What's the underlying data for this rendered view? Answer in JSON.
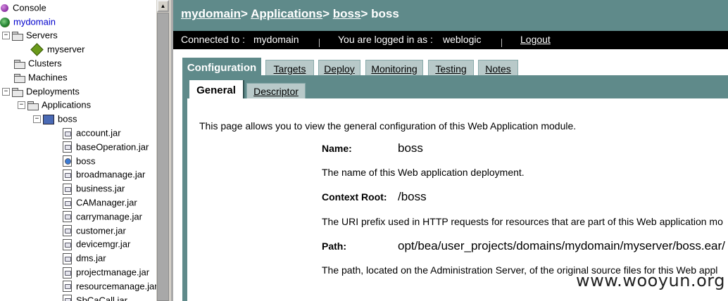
{
  "tree": {
    "console": "Console",
    "domain": "mydomain",
    "servers": "Servers",
    "server": "myserver",
    "clusters": "Clusters",
    "machines": "Machines",
    "deployments": "Deployments",
    "applications": "Applications",
    "app": "boss",
    "modules": [
      "account.jar",
      "baseOperation.jar",
      "boss",
      "broadmanage.jar",
      "business.jar",
      "CAManager.jar",
      "carrymanage.jar",
      "customer.jar",
      "devicemgr.jar",
      "dms.jar",
      "projectmanage.jar",
      "resourcemanage.jar",
      "SbCaCall.jar"
    ],
    "expand_symbol": "−"
  },
  "header": {
    "crumb_domain": "mydomain",
    "crumb_apps": "Applications",
    "crumb_boss": "boss",
    "crumb_current": "boss",
    "sep": ">"
  },
  "status": {
    "connected_label": "Connected to :",
    "connected_value": "mydomain",
    "logged_label": "You are logged in as :",
    "logged_value": "weblogic",
    "logout": "Logout"
  },
  "tabs": [
    "Configuration",
    "Targets",
    "Deploy",
    "Monitoring",
    "Testing",
    "Notes"
  ],
  "subtabs": [
    "General",
    "Descriptor"
  ],
  "content": {
    "intro": "This page allows you to view the general configuration of this Web Application module.",
    "name_label": "Name:",
    "name_value": "boss",
    "name_desc": "The name of this Web application deployment.",
    "root_label": "Context Root:",
    "root_value": "/boss",
    "root_desc": "The URI prefix used in HTTP requests for resources that are part of this Web application mo",
    "path_label": "Path:",
    "path_value": "opt/bea/user_projects/domains/mydomain/myserver/boss.ear/",
    "path_desc": "The path, located on the Administration Server, of the original source files for this Web appl"
  },
  "watermark": "www.wooyun.org",
  "colors": {
    "accent": "#5f8a8a",
    "tab": "#b8c9c9",
    "status": "#000000"
  }
}
